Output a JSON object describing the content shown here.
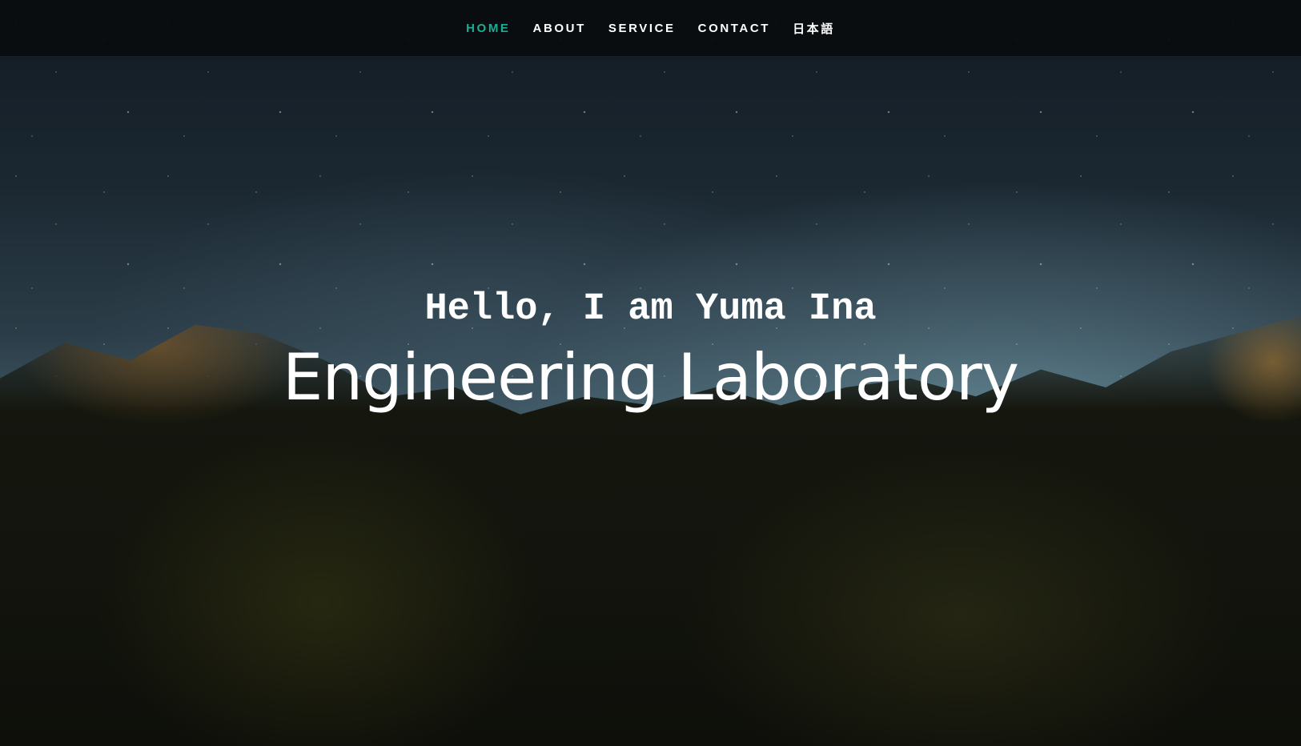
{
  "nav": {
    "items": [
      {
        "label": "HOME",
        "active": true
      },
      {
        "label": "ABOUT",
        "active": false
      },
      {
        "label": "SERVICE",
        "active": false
      },
      {
        "label": "CONTACT",
        "active": false
      },
      {
        "label": "日本語",
        "active": false
      }
    ],
    "active_color": "#1aae96"
  },
  "hero": {
    "greeting": "Hello, I am Yuma Ina",
    "title": "Engineering Laboratory",
    "background": "night-sky-forest-photo"
  }
}
